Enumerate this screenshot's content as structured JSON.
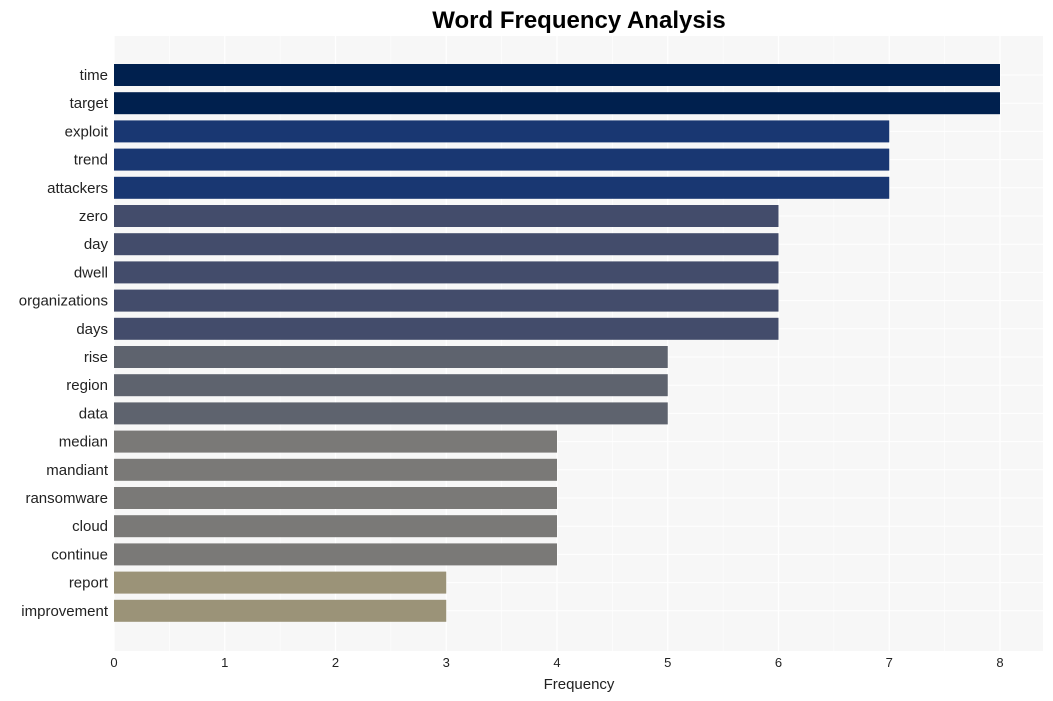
{
  "chart_data": {
    "type": "bar",
    "orientation": "horizontal",
    "title": "Word Frequency Analysis",
    "xlabel": "Frequency",
    "ylabel": "",
    "xlim": [
      0,
      8.4
    ],
    "xticks": [
      0,
      1,
      2,
      3,
      4,
      5,
      6,
      7,
      8
    ],
    "grid": true,
    "legend": "none",
    "categories": [
      "time",
      "target",
      "exploit",
      "trend",
      "attackers",
      "zero",
      "day",
      "dwell",
      "organizations",
      "days",
      "rise",
      "region",
      "data",
      "median",
      "mandiant",
      "ransomware",
      "cloud",
      "continue",
      "report",
      "improvement"
    ],
    "values": [
      8,
      8,
      7,
      7,
      7,
      6,
      6,
      6,
      6,
      6,
      5,
      5,
      5,
      4,
      4,
      4,
      4,
      4,
      3,
      3
    ],
    "colors_by_value": {
      "8": "#00204e",
      "7": "#193772",
      "6": "#434c6b",
      "5": "#5e636e",
      "4": "#7a7977",
      "3": "#9b9378"
    },
    "background": "#f7f7f7",
    "gridline_color": "#ffffff"
  }
}
